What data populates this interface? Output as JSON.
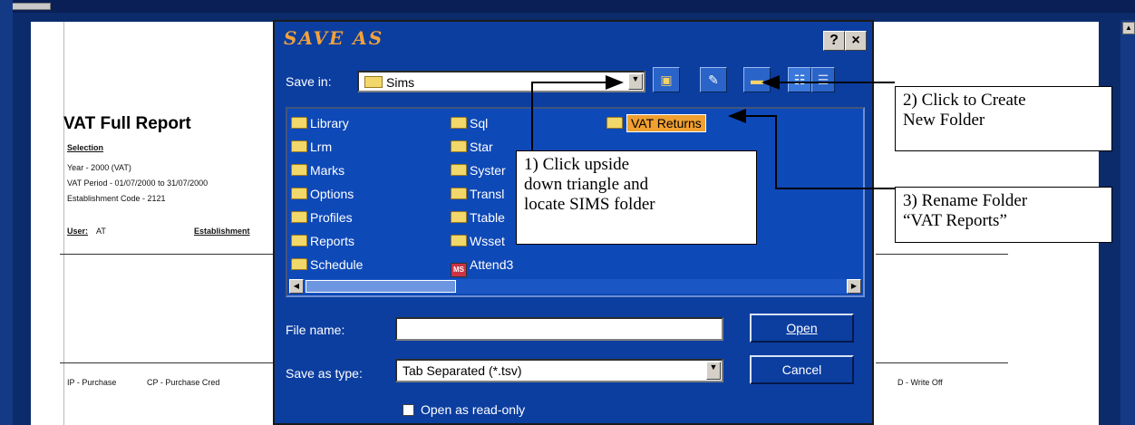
{
  "report": {
    "title": "VAT Full Report",
    "selection": "Selection",
    "year": "Year - 2000 (VAT)",
    "period": "VAT Period - 01/07/2000 to 31/07/2000",
    "estab_code": "Establishment Code - 2121",
    "user_label": "User:",
    "user_value": "AT",
    "estab_label": "Establishment",
    "ip_text": "IP - Purchase",
    "cp_text": "CP - Purchase Cred",
    "wo_text": "D - Write Off"
  },
  "dialog": {
    "title": "SAVE AS",
    "help": "?",
    "close": "×",
    "save_in_label": "Save in:",
    "save_in_value": "Sims",
    "folders": [
      "Library",
      "Lrm",
      "Marks",
      "Options",
      "Profiles",
      "Reports",
      "Schedule",
      "Sql",
      "Star",
      "Syster",
      "Transl",
      "Ttable",
      "Wsset"
    ],
    "attend_item": "Attend3",
    "selected_folder": "VAT Returns",
    "file_name_label": "File name:",
    "file_name_value": "",
    "save_as_type_label": "Save as type:",
    "save_as_type_value": "Tab Separated (*.tsv)",
    "open_button": "Open",
    "cancel_button": "Cancel",
    "read_only_label": "Open as read-only"
  },
  "callouts": {
    "c1_l1": "1) Click upside",
    "c1_l2": "down triangle and",
    "c1_l3": "locate SIMS folder",
    "c2_l1": "2) Click to Create",
    "c2_l2": "New Folder",
    "c3_l1": "3) Rename Folder",
    "c3_l2": "“VAT Reports”"
  },
  "icons": [
    "folder-icon",
    "up-folder-icon",
    "desktop-icon",
    "new-folder-icon",
    "list-view-icon",
    "details-view-icon",
    "chevron-down-icon",
    "scroll-left-icon",
    "scroll-right-icon",
    "help-icon",
    "close-icon"
  ],
  "colors": {
    "dialog_bg": "#0c3ea0",
    "title": "#f2a23a",
    "selected": "#f0a030"
  }
}
